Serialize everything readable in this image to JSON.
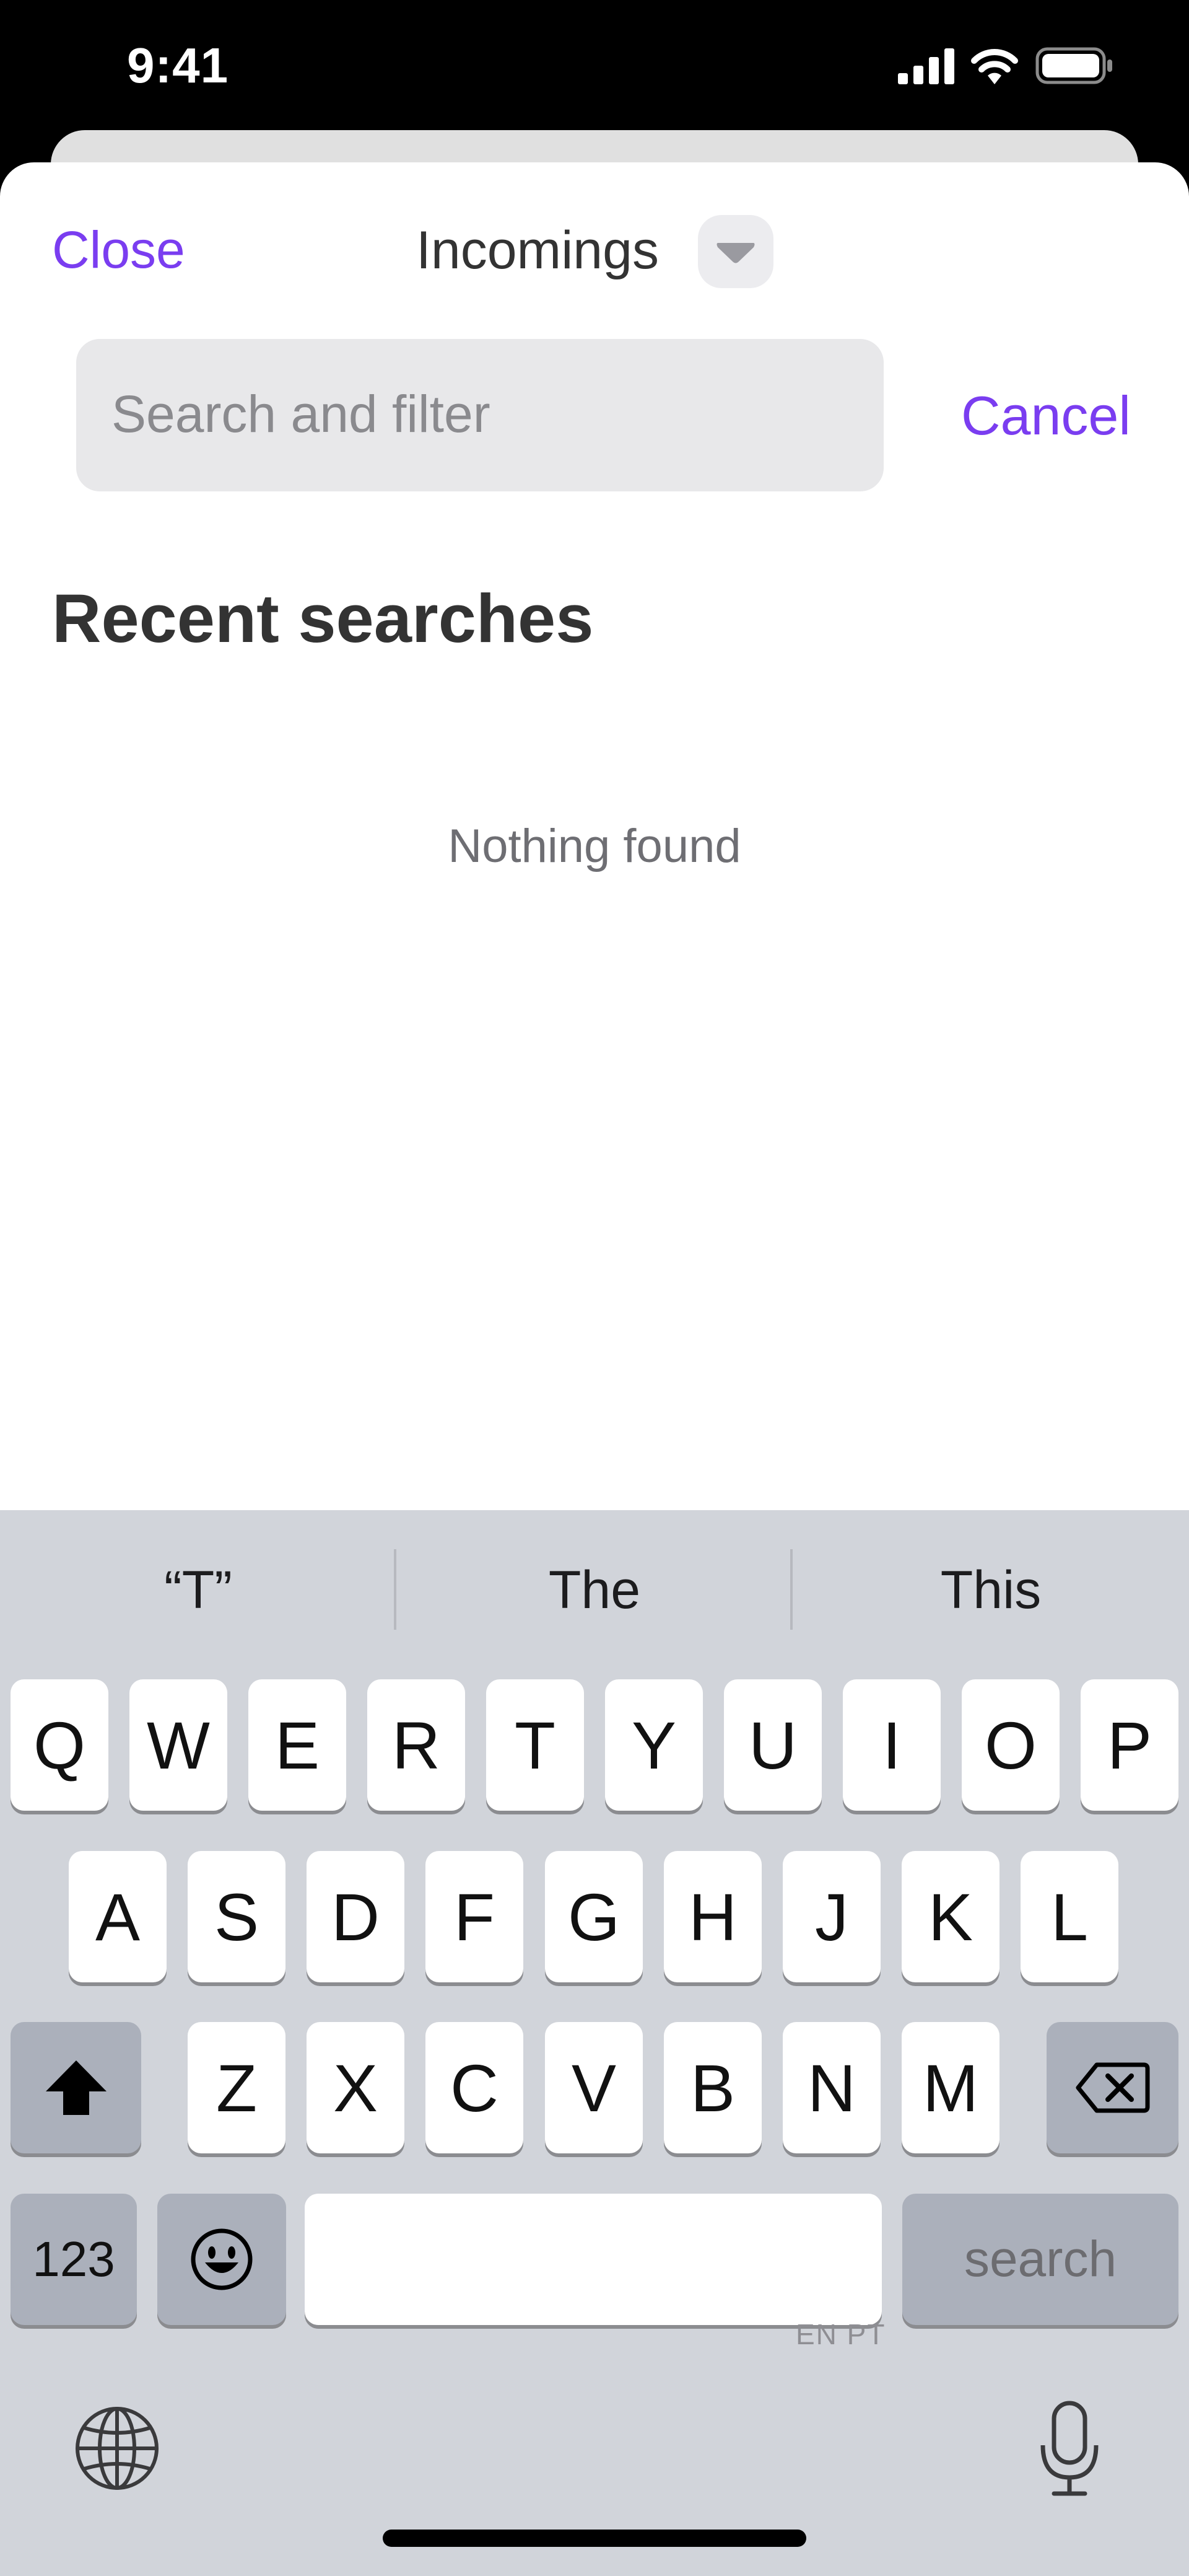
{
  "status_bar": {
    "time": "9:41"
  },
  "header": {
    "close_label": "Close",
    "title": "Incomings",
    "dropdown_icon": "chevron-down-icon"
  },
  "search": {
    "placeholder": "Search and filter",
    "value": "",
    "cancel_label": "Cancel"
  },
  "recent": {
    "title": "Recent searches",
    "empty_text": "Nothing found"
  },
  "accent_color": "#7a3df0",
  "keyboard": {
    "suggestions": [
      "“T”",
      "The",
      "This"
    ],
    "row1": [
      "Q",
      "W",
      "E",
      "R",
      "T",
      "Y",
      "U",
      "I",
      "O",
      "P"
    ],
    "row2": [
      "A",
      "S",
      "D",
      "F",
      "G",
      "H",
      "J",
      "K",
      "L"
    ],
    "row3": [
      "Z",
      "X",
      "C",
      "V",
      "B",
      "N",
      "M"
    ],
    "numbers_label": "123",
    "search_label": "search",
    "space_language": "EN PT"
  }
}
